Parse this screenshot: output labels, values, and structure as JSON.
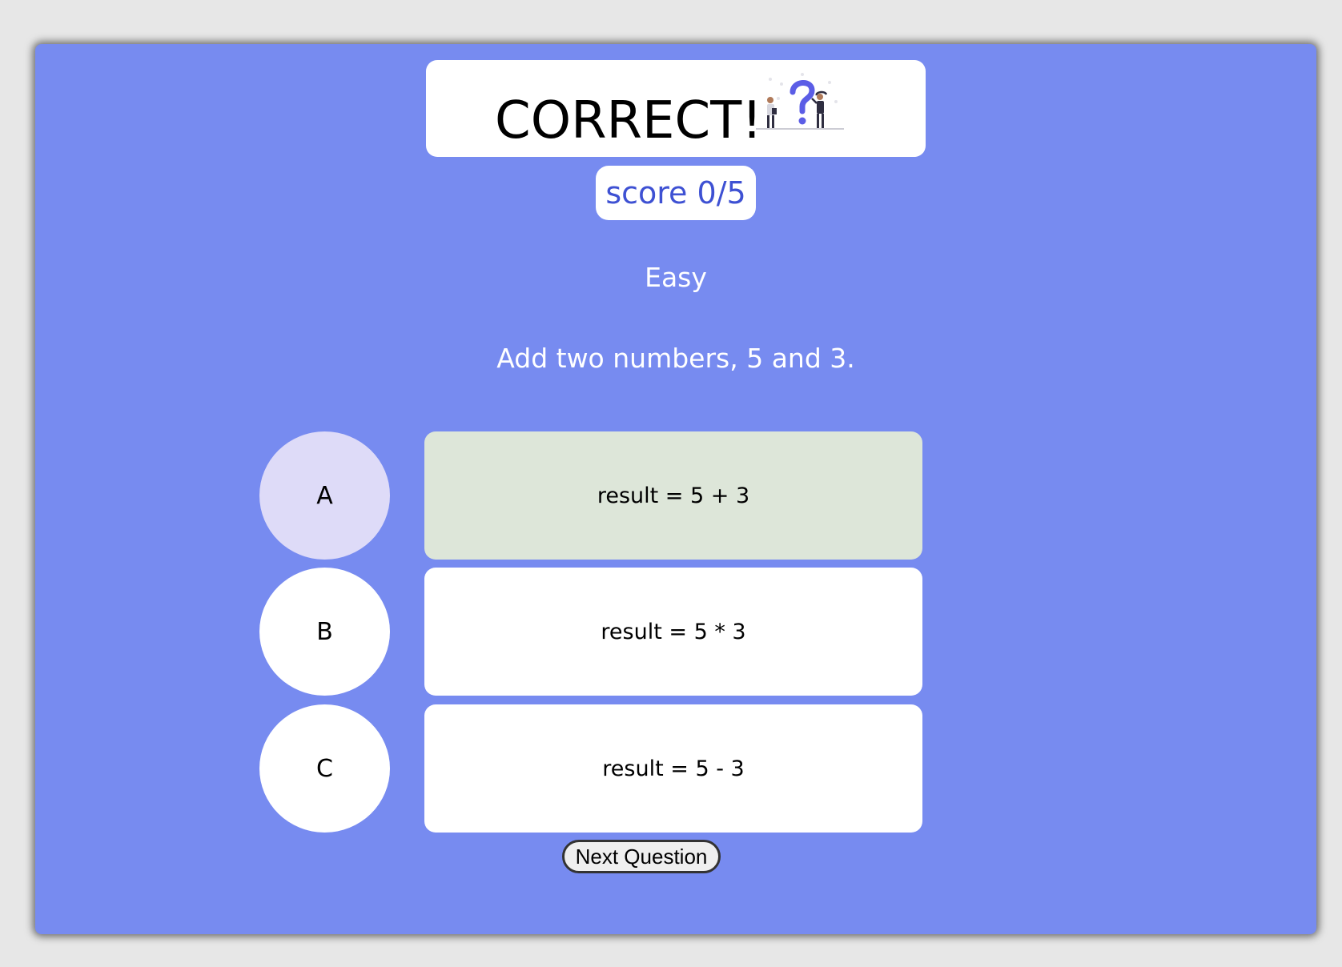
{
  "header": {
    "result_text": "CORRECT!",
    "illustration_icon": "people-question-mark-illustration"
  },
  "score": {
    "label": "score 0/5"
  },
  "quiz": {
    "difficulty": "Easy",
    "question": "Add two numbers, 5 and 3."
  },
  "options": [
    {
      "letter": "A",
      "answer": "result = 5 + 3",
      "state": "correct-selected"
    },
    {
      "letter": "B",
      "answer": "result = 5 * 3",
      "state": "default"
    },
    {
      "letter": "C",
      "answer": "result = 5 - 3",
      "state": "default"
    }
  ],
  "actions": {
    "next_label": "Next Question"
  },
  "colors": {
    "background": "#778bf0",
    "page": "#e7e7e7",
    "score_text": "#3e51d3",
    "selected_letter": "#dedbf8",
    "correct_answer": "#dde6d9",
    "illustration_accent": "#5b5de6"
  }
}
